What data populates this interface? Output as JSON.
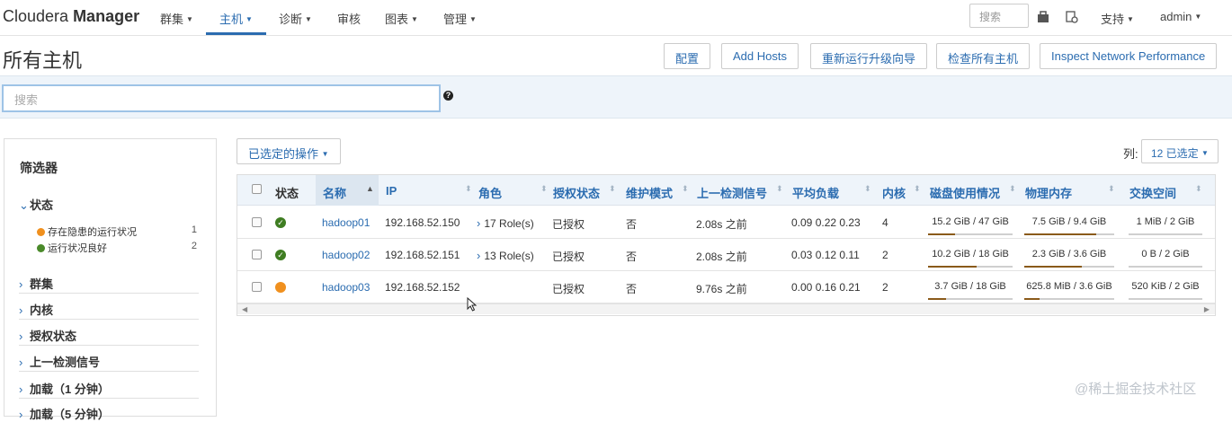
{
  "brand": {
    "name_light": "Cloudera",
    "name_bold": "Manager"
  },
  "nav": {
    "items": [
      {
        "label": "群集",
        "caret": true
      },
      {
        "label": "主机",
        "caret": true
      },
      {
        "label": "诊断",
        "caret": true
      },
      {
        "label": "审核",
        "caret": false
      },
      {
        "label": "图表",
        "caret": true
      },
      {
        "label": "管理",
        "caret": true
      }
    ],
    "active": "主机",
    "search_placeholder": "搜索",
    "support_label": "支持",
    "user_label": "admin"
  },
  "page": {
    "title": "所有主机",
    "buttons": [
      "配置",
      "Add Hosts",
      "重新运行升级向导",
      "检查所有主机",
      "Inspect Network Performance"
    ],
    "search_placeholder": "搜索"
  },
  "filters": {
    "title": "筛选器",
    "status_section": "状态",
    "status_items": [
      {
        "label": "存在隐患的运行状况",
        "count": "1",
        "color": "#f0901e"
      },
      {
        "label": "运行状况良好",
        "count": "2",
        "color": "#4a8a2a"
      }
    ],
    "sections": [
      "群集",
      "内核",
      "授权状态",
      "上一检测信号",
      "加载（1 分钟）",
      "加载（5 分钟）"
    ]
  },
  "toolbar": {
    "actions_label": "已选定的操作",
    "columns_label": "列:",
    "columns_selected": "12 已选定"
  },
  "table": {
    "columns": [
      "状态",
      "名称",
      "IP",
      "角色",
      "授权状态",
      "维护模式",
      "上一检测信号",
      "平均负载",
      "内核",
      "磁盘使用情况",
      "物理内存",
      "交换空间"
    ],
    "rows": [
      {
        "status": "good",
        "name": "hadoop01",
        "ip": "192.168.52.150",
        "roles": "17 Role(s)",
        "auth": "已授权",
        "maintenance": "否",
        "heartbeat": "2.08s 之前",
        "load": "0.09  0.22  0.23",
        "cores": "4",
        "disk": "15.2 GiB / 47 GiB",
        "disk_pct": 32,
        "mem": "7.5 GiB / 9.4 GiB",
        "mem_pct": 80,
        "swap": "1 MiB / 2 GiB",
        "swap_pct": 0
      },
      {
        "status": "good",
        "name": "hadoop02",
        "ip": "192.168.52.151",
        "roles": "13 Role(s)",
        "auth": "已授权",
        "maintenance": "否",
        "heartbeat": "2.08s 之前",
        "load": "0.03  0.12  0.11",
        "cores": "2",
        "disk": "10.2 GiB / 18 GiB",
        "disk_pct": 57,
        "mem": "2.3 GiB / 3.6 GiB",
        "mem_pct": 64,
        "swap": "0 B / 2 GiB",
        "swap_pct": 0
      },
      {
        "status": "warning",
        "name": "hadoop03",
        "ip": "192.168.52.152",
        "roles": "",
        "auth": "已授权",
        "maintenance": "否",
        "heartbeat": "9.76s 之前",
        "load": "0.00  0.16  0.21",
        "cores": "2",
        "disk": "3.7 GiB / 18 GiB",
        "disk_pct": 21,
        "mem": "625.8 MiB / 3.6 GiB",
        "mem_pct": 17,
        "swap": "520 KiB / 2 GiB",
        "swap_pct": 0
      }
    ]
  },
  "watermark": "@稀土掘金技术社区"
}
